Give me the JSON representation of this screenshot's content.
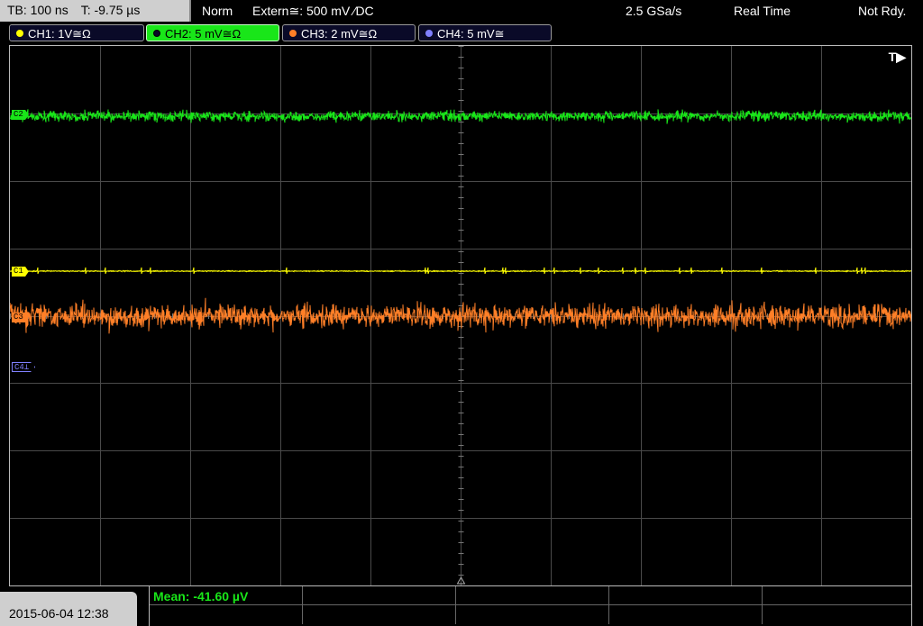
{
  "topbar": {
    "timebase": "TB: 100 ns",
    "trigger_time": "T: -9.75 µs",
    "mode": "Norm",
    "trigger_source": "Extern≅: 500 mV ⁄DC",
    "sample_rate": "2.5 GSa/s",
    "acq_mode": "Real Time",
    "status": "Not Rdy."
  },
  "channels": [
    {
      "label": "CH1: 1V≅Ω",
      "color": "#ffff00",
      "active": false
    },
    {
      "label": "CH2: 5 mV≅Ω",
      "color": "#19e619",
      "active": true
    },
    {
      "label": "CH3: 2 mV≅Ω",
      "color": "#ff7f27",
      "active": false
    },
    {
      "label": "CH4: 5 mV≅",
      "color": "#8080ff",
      "active": false
    }
  ],
  "plot": {
    "trigger_marker": "T▶",
    "markers": {
      "ch2": "C2",
      "ch1": "C1",
      "ch3": "C3",
      "ch4": "C4⊥"
    }
  },
  "footer": {
    "datetime": "2015-06-04 12:38",
    "measurement": "Mean: -41.60 µV"
  },
  "colors": {
    "ch1": "#ffff00",
    "ch2": "#19e619",
    "ch3": "#ff7f27",
    "ch4": "#8080ff",
    "grid": "#4a4a4a"
  }
}
